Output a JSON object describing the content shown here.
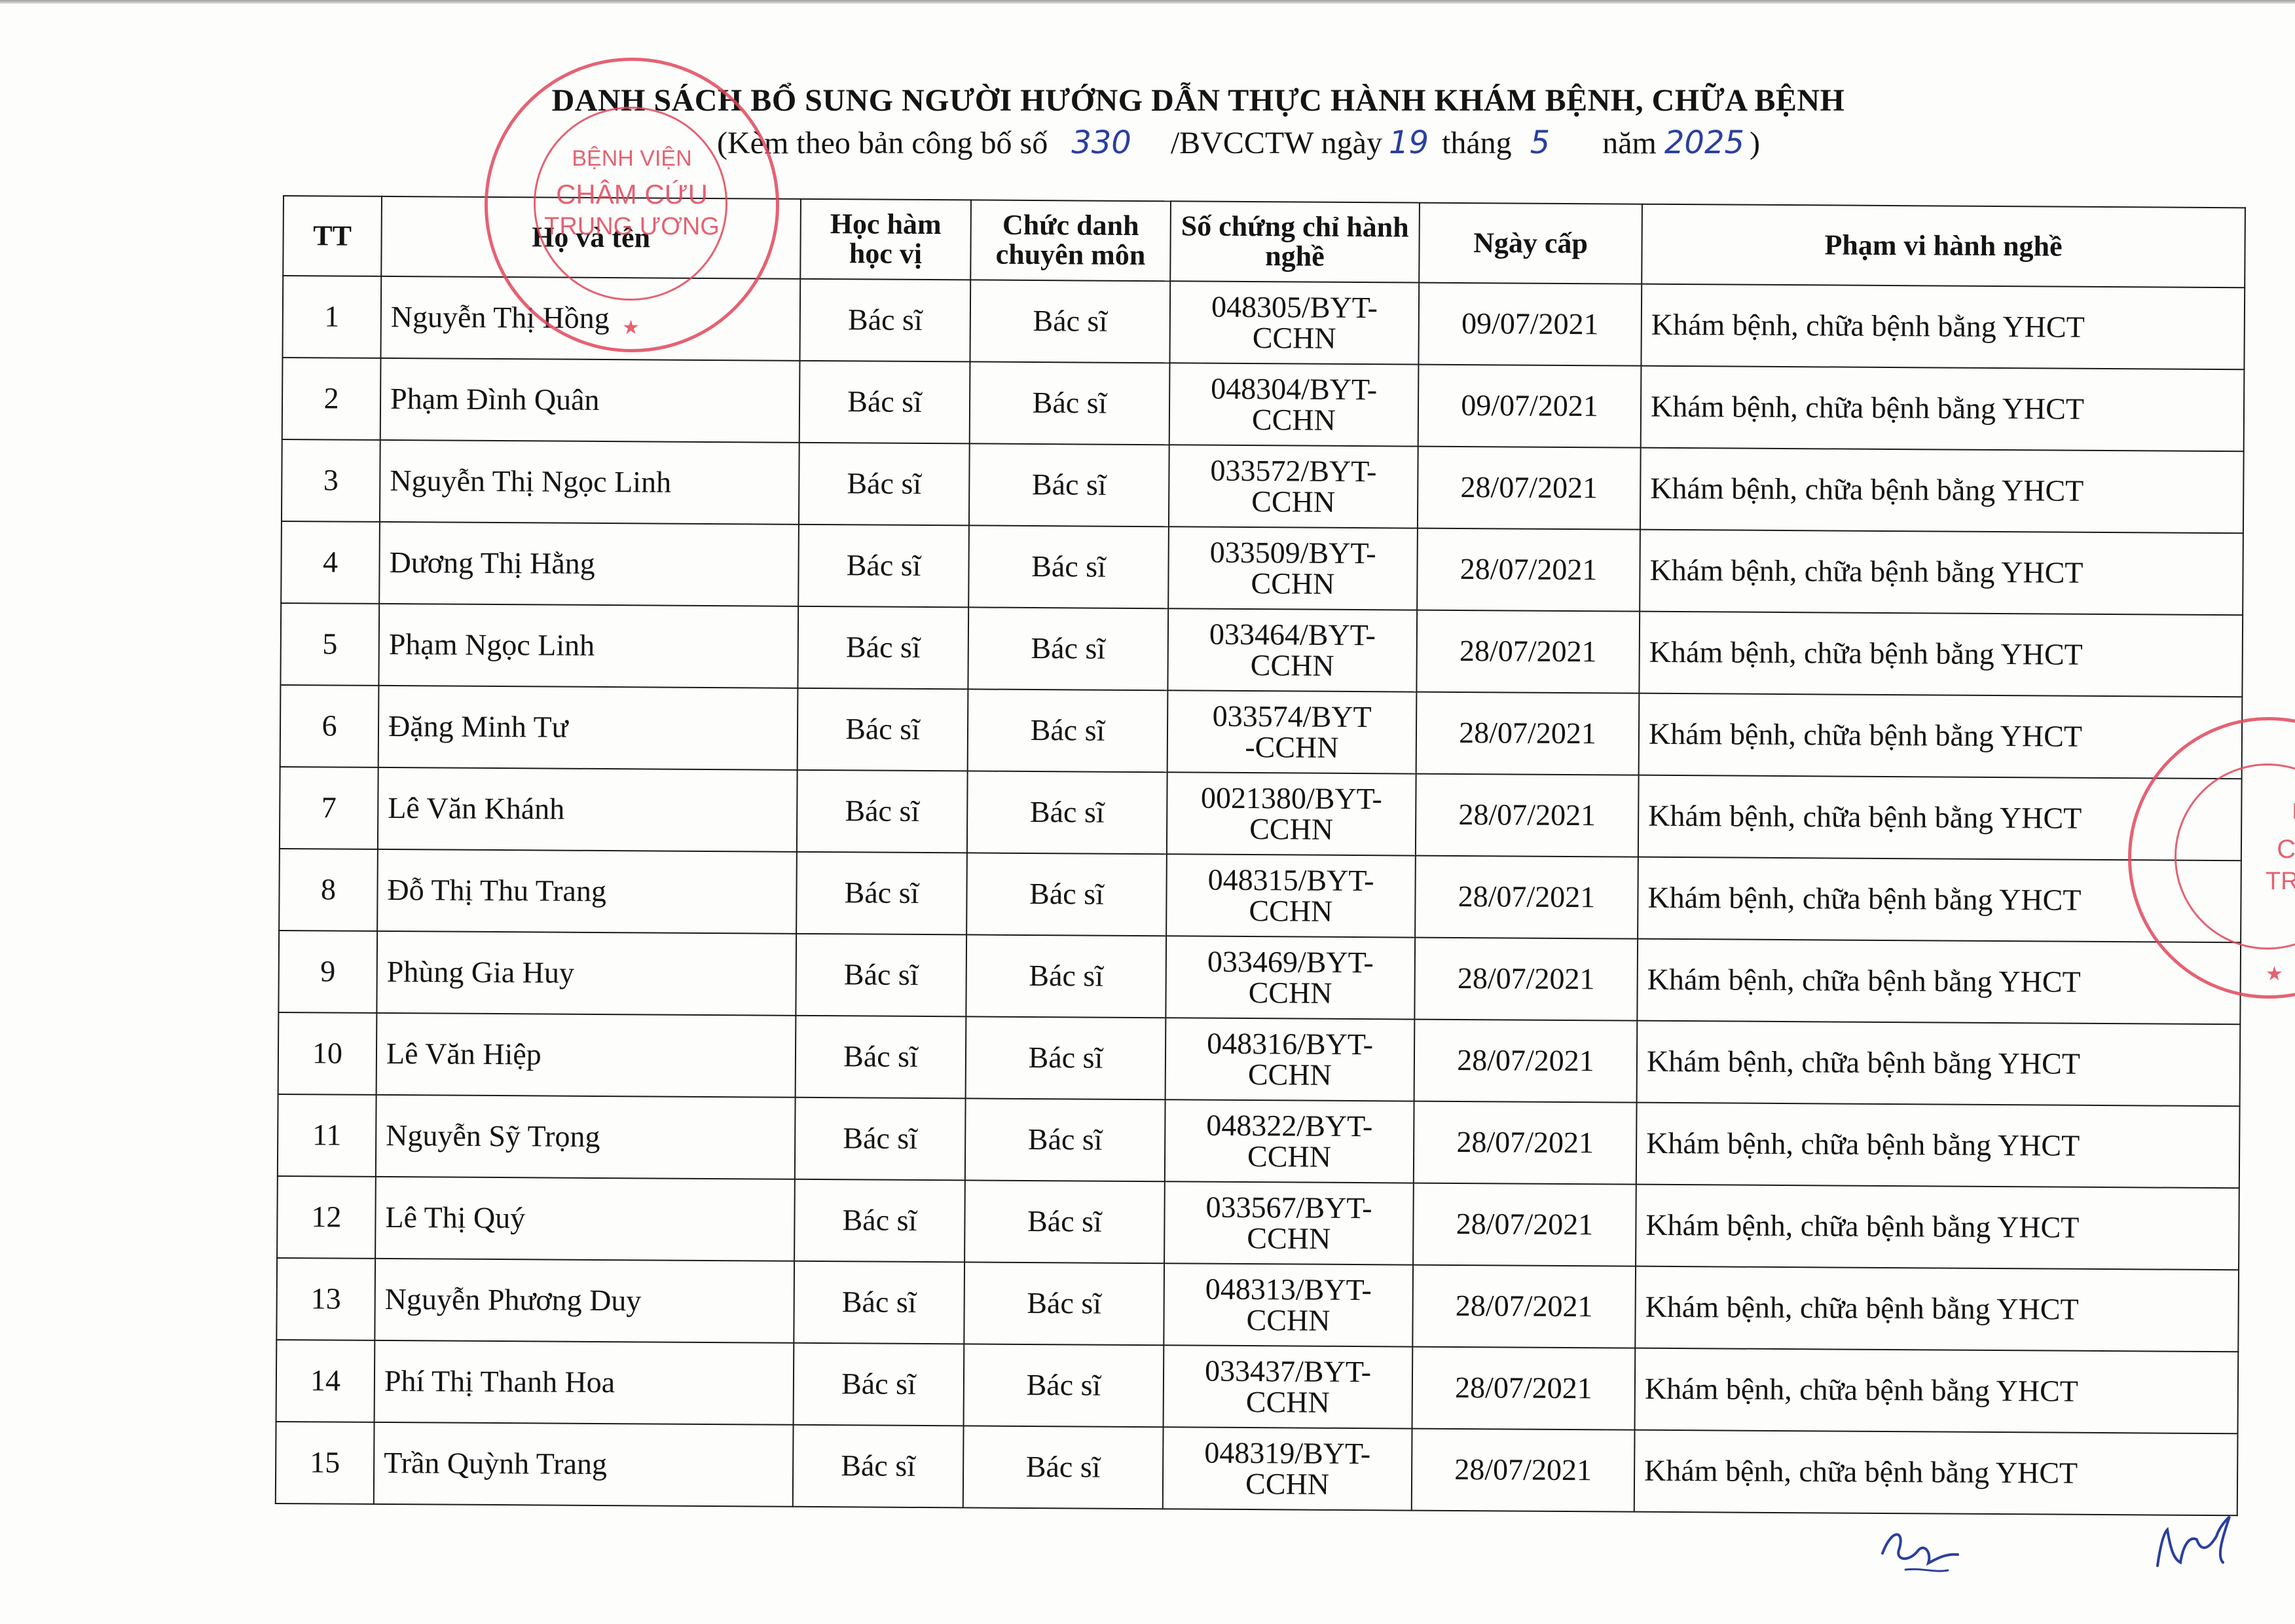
{
  "document": {
    "title": "DANH SÁCH BỔ SUNG NGƯỜI HƯỚNG DẪN THỰC HÀNH KHÁM BỆNH, CHỮA BỆNH",
    "subtitle": {
      "prefix": "(Kèm theo bản công bố số",
      "number": "330",
      "issuer": "/BVCCTW ngày",
      "day": "19",
      "month_word": "tháng",
      "month": "5",
      "year_word": "năm",
      "year": "2025",
      "close": ")"
    }
  },
  "table": {
    "headers": {
      "tt": "TT",
      "name": "Họ và tên",
      "degree": "Học hàm học vị",
      "title": "Chức danh chuyên môn",
      "cert": "Số chứng chỉ hành nghề",
      "date": "Ngày cấp",
      "scope": "Phạm vi hành nghề"
    },
    "rows": [
      {
        "tt": "1",
        "name": "Nguyễn Thị Hồng",
        "degree": "Bác sĩ",
        "title": "Bác sĩ",
        "cert_1": "048305/BYT-",
        "cert_2": "CCHN",
        "date": "09/07/2021",
        "scope": "Khám bệnh, chữa bệnh bằng YHCT"
      },
      {
        "tt": "2",
        "name": "Phạm Đình Quân",
        "degree": "Bác sĩ",
        "title": "Bác sĩ",
        "cert_1": "048304/BYT-",
        "cert_2": "CCHN",
        "date": "09/07/2021",
        "scope": "Khám bệnh, chữa bệnh bằng YHCT"
      },
      {
        "tt": "3",
        "name": "Nguyễn Thị Ngọc Linh",
        "degree": "Bác sĩ",
        "title": "Bác sĩ",
        "cert_1": "033572/BYT-",
        "cert_2": "CCHN",
        "date": "28/07/2021",
        "scope": "Khám bệnh, chữa bệnh bằng YHCT"
      },
      {
        "tt": "4",
        "name": "Dương Thị Hằng",
        "degree": "Bác sĩ",
        "title": "Bác sĩ",
        "cert_1": "033509/BYT-",
        "cert_2": "CCHN",
        "date": "28/07/2021",
        "scope": "Khám bệnh, chữa bệnh bằng YHCT"
      },
      {
        "tt": "5",
        "name": "Phạm Ngọc Linh",
        "degree": "Bác sĩ",
        "title": "Bác sĩ",
        "cert_1": "033464/BYT-",
        "cert_2": "CCHN",
        "date": "28/07/2021",
        "scope": "Khám bệnh, chữa bệnh bằng YHCT"
      },
      {
        "tt": "6",
        "name": "Đặng Minh Tư",
        "degree": "Bác sĩ",
        "title": "Bác sĩ",
        "cert_1": "033574/BYT",
        "cert_2": "-CCHN",
        "date": "28/07/2021",
        "scope": "Khám bệnh, chữa bệnh bằng YHCT"
      },
      {
        "tt": "7",
        "name": "Lê Văn Khánh",
        "degree": "Bác sĩ",
        "title": "Bác sĩ",
        "cert_1": "0021380/BYT-",
        "cert_2": "CCHN",
        "date": "28/07/2021",
        "scope": "Khám bệnh, chữa bệnh bằng YHCT"
      },
      {
        "tt": "8",
        "name": "Đỗ Thị Thu Trang",
        "degree": "Bác sĩ",
        "title": "Bác sĩ",
        "cert_1": "048315/BYT-",
        "cert_2": "CCHN",
        "date": "28/07/2021",
        "scope": "Khám bệnh, chữa bệnh bằng YHCT"
      },
      {
        "tt": "9",
        "name": "Phùng Gia Huy",
        "degree": "Bác sĩ",
        "title": "Bác sĩ",
        "cert_1": "033469/BYT-",
        "cert_2": "CCHN",
        "date": "28/07/2021",
        "scope": "Khám bệnh, chữa bệnh bằng YHCT"
      },
      {
        "tt": "10",
        "name": "Lê Văn Hiệp",
        "degree": "Bác sĩ",
        "title": "Bác sĩ",
        "cert_1": "048316/BYT-",
        "cert_2": "CCHN",
        "date": "28/07/2021",
        "scope": "Khám bệnh, chữa bệnh bằng YHCT"
      },
      {
        "tt": "11",
        "name": "Nguyễn Sỹ Trọng",
        "degree": "Bác sĩ",
        "title": "Bác sĩ",
        "cert_1": "048322/BYT-",
        "cert_2": "CCHN",
        "date": "28/07/2021",
        "scope": "Khám bệnh, chữa bệnh bằng YHCT"
      },
      {
        "tt": "12",
        "name": "Lê Thị Quý",
        "degree": "Bác sĩ",
        "title": "Bác sĩ",
        "cert_1": "033567/BYT-",
        "cert_2": "CCHN",
        "date": "28/07/2021",
        "scope": "Khám bệnh, chữa bệnh bằng YHCT"
      },
      {
        "tt": "13",
        "name": "Nguyễn Phương Duy",
        "degree": "Bác sĩ",
        "title": "Bác sĩ",
        "cert_1": "048313/BYT-",
        "cert_2": "CCHN",
        "date": "28/07/2021",
        "scope": "Khám bệnh, chữa bệnh bằng YHCT"
      },
      {
        "tt": "14",
        "name": "Phí Thị Thanh Hoa",
        "degree": "Bác sĩ",
        "title": "Bác sĩ",
        "cert_1": "033437/BYT-",
        "cert_2": "CCHN",
        "date": "28/07/2021",
        "scope": "Khám bệnh, chữa bệnh bằng YHCT"
      },
      {
        "tt": "15",
        "name": "Trần Quỳnh Trang",
        "degree": "Bác sĩ",
        "title": "Bác sĩ",
        "cert_1": "048319/BYT-",
        "cert_2": "CCHN",
        "date": "28/07/2021",
        "scope": "Khám bệnh, chữa bệnh bằng YHCT"
      }
    ]
  },
  "stamps": {
    "color": "#e0475a",
    "main": {
      "line1": "BỆNH VIỆN",
      "line2": "CHÂM CỨU",
      "line3": "TRUNG ƯƠNG"
    },
    "side": {
      "line1": "BỆNH",
      "line2": "CHÂM",
      "line3": "TRUNG"
    }
  },
  "colors": {
    "ink": "#141414",
    "handwriting": "#2a3f9e"
  }
}
